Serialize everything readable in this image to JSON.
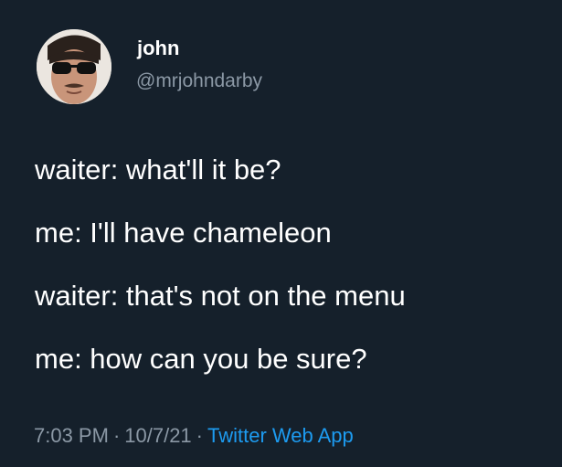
{
  "author": {
    "display_name": "john",
    "handle": "@mrjohndarby",
    "avatar_icon": "profile-photo"
  },
  "tweet": {
    "lines": [
      "waiter: what'll it be?",
      "me: I'll have chameleon",
      "waiter: that's not on the menu",
      "me: how can you be sure?"
    ],
    "time": "7:03 PM",
    "date": "10/7/21",
    "separator": "·",
    "source": "Twitter Web App"
  },
  "colors": {
    "background": "#15202b",
    "text": "#ffffff",
    "secondary_text": "#8b98a5",
    "link": "#1d9bf0"
  }
}
